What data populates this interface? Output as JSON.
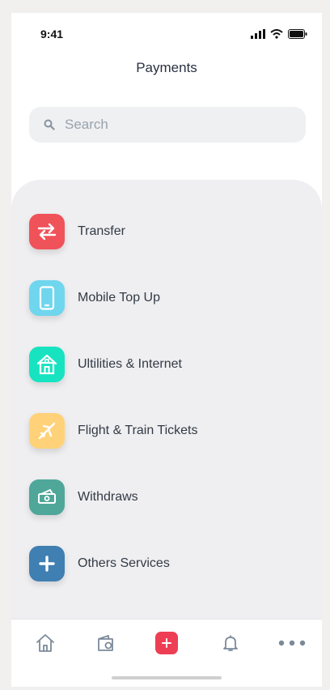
{
  "status_bar": {
    "time": "9:41"
  },
  "header": {
    "title": "Payments"
  },
  "search": {
    "placeholder": "Search"
  },
  "services": [
    {
      "label": "Transfer",
      "icon": "transfer-arrows-icon",
      "color": "#f0525a"
    },
    {
      "label": "Mobile Top Up",
      "icon": "mobile-phone-icon",
      "color": "#6fd6ee"
    },
    {
      "label": "Ultilities & Internet",
      "icon": "house-icon",
      "color": "#17e3c1"
    },
    {
      "label": "Flight & Train Tickets",
      "icon": "airplane-icon",
      "color": "#ffd27a"
    },
    {
      "label": "Withdraws",
      "icon": "cash-hand-icon",
      "color": "#4fa79a"
    },
    {
      "label": "Others Services",
      "icon": "plus-icon",
      "color": "#3f7fb2"
    }
  ],
  "bottom_nav": [
    {
      "name": "home",
      "icon": "home-icon"
    },
    {
      "name": "wallet",
      "icon": "wallet-icon"
    },
    {
      "name": "add",
      "icon": "add-icon",
      "color": "#ee3e54"
    },
    {
      "name": "notifications",
      "icon": "bell-icon"
    },
    {
      "name": "more",
      "icon": "more-dots-icon"
    }
  ]
}
